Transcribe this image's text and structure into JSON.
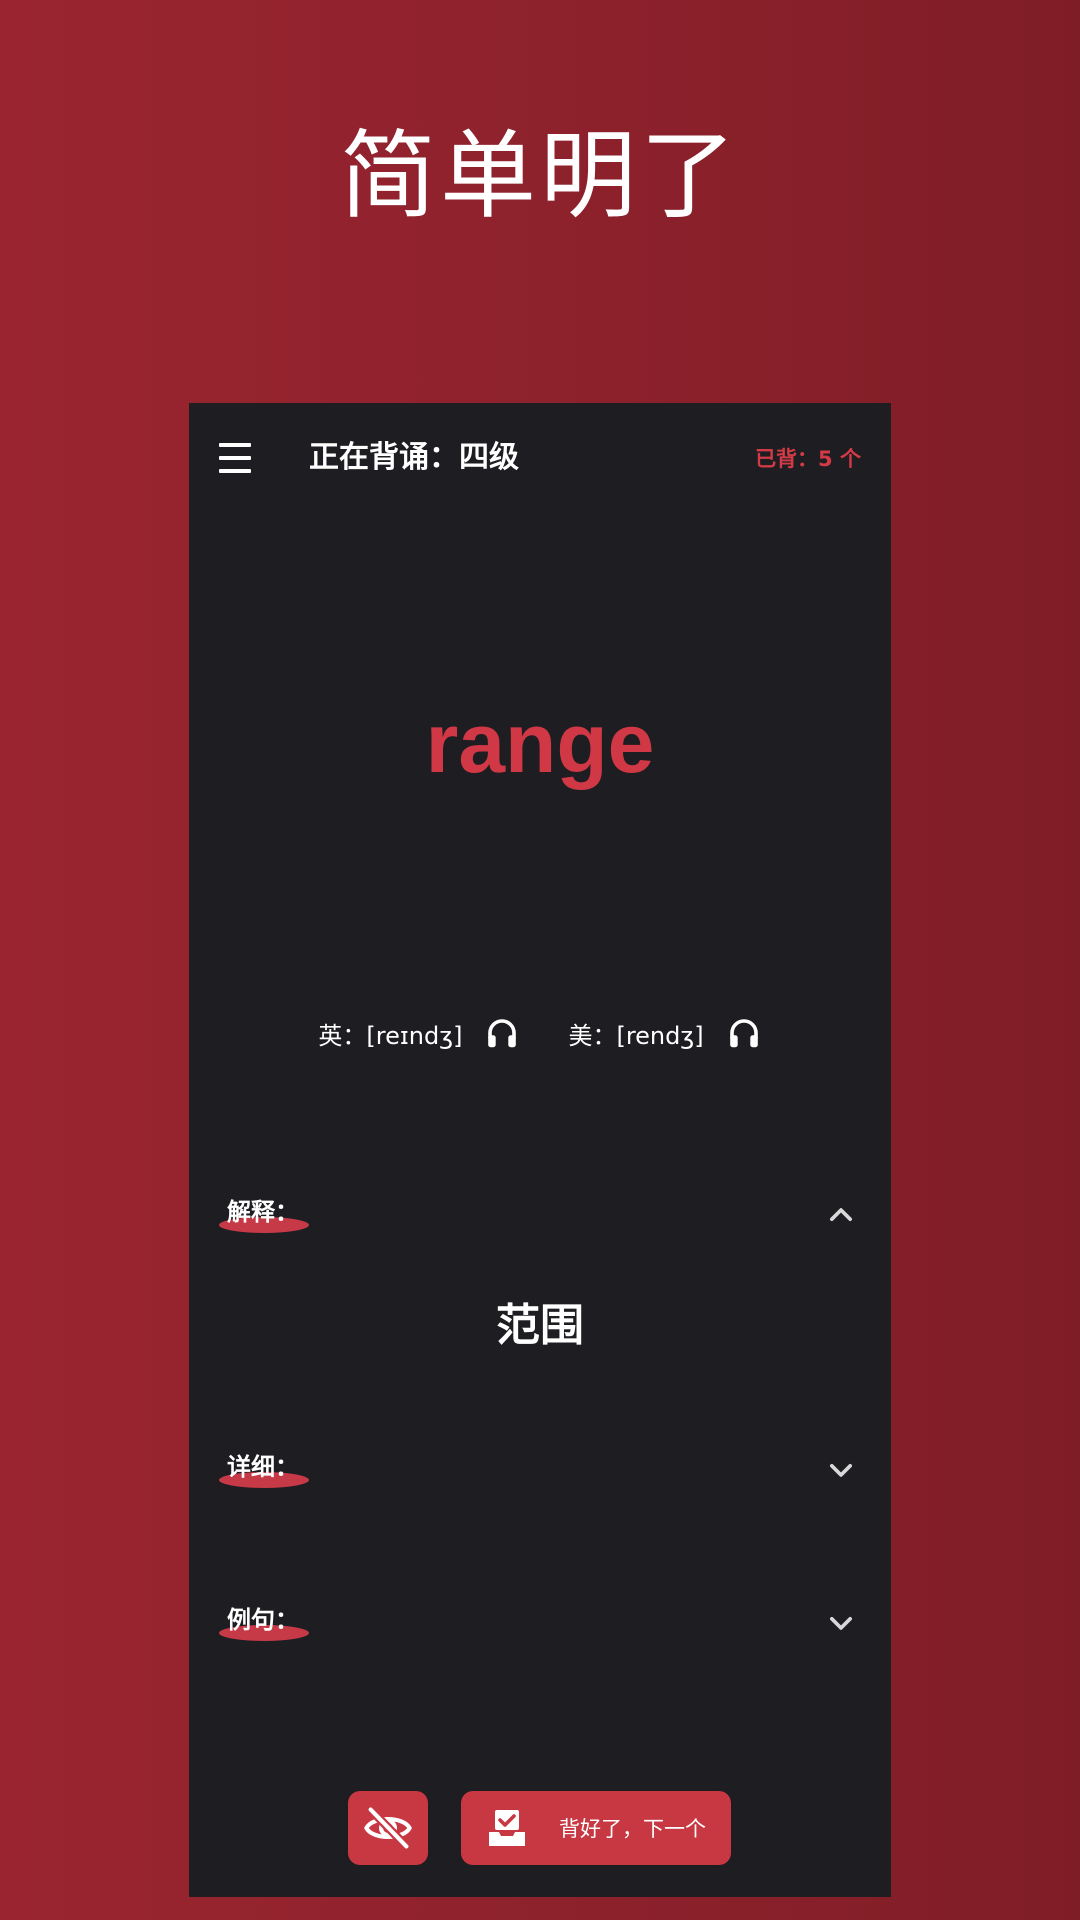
{
  "headline": "简单明了",
  "app_bar": {
    "menu_icon": "menu-icon",
    "status_label": "正在背诵：四级",
    "learned_count": "已背：5 个",
    "accent_color": "#d23a45"
  },
  "word": "range",
  "pronunciation": {
    "uk": {
      "label": "英：[reɪndʒ]",
      "icon": "headphones-icon"
    },
    "us": {
      "label": "美：[rendʒ]",
      "icon": "headphones-icon"
    }
  },
  "sections": {
    "meaning": {
      "label": "解释：",
      "expanded": true,
      "content": "范围",
      "icon": "chevron-up-icon"
    },
    "detail": {
      "label": "详细：",
      "expanded": false,
      "icon": "chevron-down-icon"
    },
    "examples": {
      "label": "例句：",
      "expanded": false,
      "icon": "chevron-down-icon"
    }
  },
  "actions": {
    "hide_icon": "eye-off-icon",
    "next_icon": "inbox-check-icon",
    "next_label": "背好了，下一个",
    "button_color": "#c83843"
  }
}
